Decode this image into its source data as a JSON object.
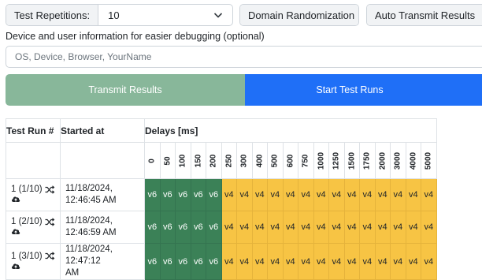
{
  "controls": {
    "repetitions_label": "Test Repetitions:",
    "repetitions_value": "10",
    "domain_randomization_label": "Domain Randomization",
    "domain_randomization_checked": true,
    "auto_transmit_label": "Auto Transmit Results",
    "auto_transmit_checked": true
  },
  "debug": {
    "label": "Device and user information for easier debugging (optional)",
    "placeholder": "OS, Device, Browser, YourName",
    "value": ""
  },
  "buttons": {
    "transmit": "Transmit Results",
    "start": "Start Test Runs"
  },
  "table": {
    "headers": {
      "run": "Test Run #",
      "started": "Started at",
      "delays": "Delays [ms]"
    },
    "delays": [
      "0",
      "50",
      "100",
      "150",
      "200",
      "250",
      "300",
      "400",
      "500",
      "600",
      "750",
      "1000",
      "1250",
      "1500",
      "1750",
      "2000",
      "3000",
      "4000",
      "5000"
    ],
    "rows": [
      {
        "run": "1 (1/10)",
        "started_line1": "11/18/2024,",
        "started_line2": "12:46:45 AM",
        "results": [
          "v6",
          "v6",
          "v6",
          "v6",
          "v6",
          "v4",
          "v4",
          "v4",
          "v4",
          "v4",
          "v4",
          "v4",
          "v4",
          "v4",
          "v4",
          "v4",
          "v4",
          "v4",
          "v4"
        ]
      },
      {
        "run": "1 (2/10)",
        "started_line1": "11/18/2024,",
        "started_line2": "12:46:59 AM",
        "results": [
          "v6",
          "v6",
          "v6",
          "v6",
          "v6",
          "v4",
          "v4",
          "v4",
          "v4",
          "v4",
          "v4",
          "v4",
          "v4",
          "v4",
          "v4",
          "v4",
          "v4",
          "v4",
          "v4"
        ]
      },
      {
        "run": "1 (3/10)",
        "started_line1": "11/18/2024, 12:47:12",
        "started_line2": "AM",
        "results": [
          "v6",
          "v6",
          "v6",
          "v6",
          "v6",
          "v4",
          "v4",
          "v4",
          "v4",
          "v4",
          "v4",
          "v4",
          "v4",
          "v4",
          "v4",
          "v4",
          "v4",
          "v4",
          "v4"
        ]
      }
    ]
  },
  "colors": {
    "v6": "#3b8157",
    "v4": "#f7c444",
    "primary": "#1f6ff7",
    "transmit_disabled": "#88b79a"
  }
}
